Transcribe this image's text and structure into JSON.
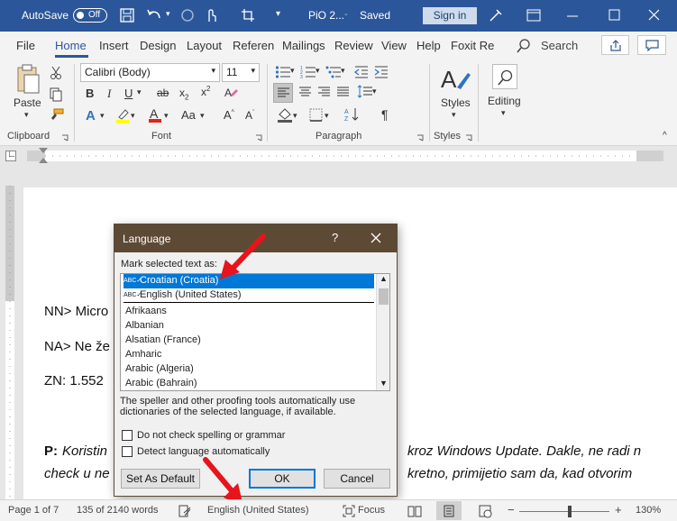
{
  "titlebar": {
    "autosave_label": "AutoSave",
    "autosave_state": "Off",
    "doc_title": "PiO 2...",
    "save_status": "Saved",
    "signin": "Sign in"
  },
  "tabs": [
    "File",
    "Home",
    "Insert",
    "Design",
    "Layout",
    "Referen",
    "Mailings",
    "Review",
    "View",
    "Help",
    "Foxit Re"
  ],
  "search_label": "Search",
  "ribbon": {
    "paste": "Paste",
    "font_name": "Calibri (Body)",
    "font_size": "11",
    "styles": "Styles",
    "editing": "Editing",
    "groups": [
      "Clipboard",
      "Font",
      "Paragraph",
      "Styles"
    ]
  },
  "document": {
    "lines": [
      "NN> Micro",
      "NA> Ne že",
      "ZN: 1.552"
    ],
    "p_label": "P:",
    "p_text_left": "Koristin",
    "p_text_right": "kroz Windows Update. Dakle, ne radi n",
    "line2_left": "check u ne",
    "line2_right": "kretno, primijetio sam da, kad otvorim"
  },
  "dialog": {
    "title": "Language",
    "help": "?",
    "prompt": "Mark selected text as:",
    "languages": [
      "Croatian (Croatia)",
      "English (United States)",
      "Afrikaans",
      "Albanian",
      "Alsatian (France)",
      "Amharic",
      "Arabic (Algeria)",
      "Arabic (Bahrain)"
    ],
    "selected_index": 0,
    "info": "The speller and other proofing tools automatically use dictionaries of the selected language, if available.",
    "check1": "Do not check spelling or grammar",
    "check2": "Detect language automatically",
    "set_default": "Set As Default",
    "ok": "OK",
    "cancel": "Cancel"
  },
  "status": {
    "page": "Page 1 of 7",
    "words": "135 of 2140 words",
    "language": "English (United States)",
    "focus": "Focus",
    "zoom": "130%"
  },
  "colors": {
    "title_blue": "#2b579a",
    "dialog_title": "#5d4a35",
    "selection": "#0078d7",
    "arrow_red": "#e8141b"
  }
}
